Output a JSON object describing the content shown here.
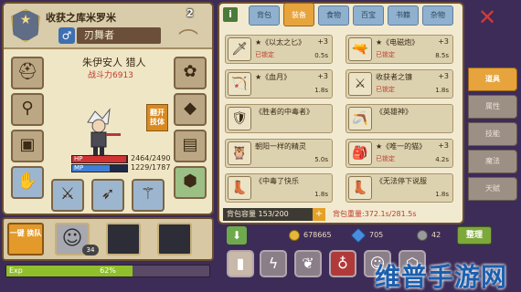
{
  "character": {
    "title": "收获之库米罗米",
    "name": "刃舞者",
    "gender_symbol": "♂",
    "page_number": "2",
    "class_line": "朱伊安人 猎人",
    "power": "战斗力6913",
    "recruit_tag": "翻开 技体",
    "hp": {
      "label": "HP",
      "value": "2464/2490",
      "fraction": 0.99
    },
    "mp": {
      "label": "MP",
      "value": "1229/1787",
      "fraction": 0.69
    }
  },
  "team": {
    "one_click_label": "一键 换队",
    "level_badge": "34"
  },
  "exp": {
    "label": "Exp",
    "percent_text": "62%",
    "fraction": 0.62
  },
  "tabs": [
    {
      "label": "背包",
      "active": false
    },
    {
      "label": "装备",
      "active": true
    },
    {
      "label": "食物",
      "active": false
    },
    {
      "label": "百宝",
      "active": false
    },
    {
      "label": "书籍",
      "active": false
    },
    {
      "label": "杂物",
      "active": false
    }
  ],
  "items": [
    {
      "name": "★《以太之匕》",
      "plus": "+3",
      "lock": "已锁定",
      "time": "0.5s",
      "icon": "🗡"
    },
    {
      "name": "★《电磁炮》",
      "plus": "+3",
      "lock": "已锁定",
      "time": "8.5s",
      "icon": "🔫"
    },
    {
      "name": "★《血月》",
      "plus": "+3",
      "lock": "",
      "time": "1.8s",
      "icon": "🏹"
    },
    {
      "name": "收获者之镰",
      "plus": "+3",
      "lock": "已锁定",
      "time": "1.8s",
      "icon": "⚔"
    },
    {
      "name": "《胜者的中毒者》",
      "plus": "",
      "lock": "",
      "time": "",
      "icon": "🛡"
    },
    {
      "name": "《英雄神》",
      "plus": "",
      "lock": "",
      "time": "",
      "icon": "🪃"
    },
    {
      "name": "朝阳一样的精灵",
      "plus": "",
      "lock": "",
      "time": "5.0s",
      "icon": "🦉"
    },
    {
      "name": "★《唯一的猫》",
      "plus": "+3",
      "lock": "已锁定",
      "time": "4.2s",
      "icon": "🎒"
    },
    {
      "name": "《中毒了快乐",
      "plus": "",
      "lock": "",
      "time": "1.8s",
      "icon": "👢"
    },
    {
      "name": "《无法停下说服",
      "plus": "",
      "lock": "",
      "time": "1.8s",
      "icon": "👢"
    }
  ],
  "bag": {
    "capacity_text": "背包容量 153/200",
    "weight_text": "背包重量:372.1s/281.5s"
  },
  "side_tabs": [
    {
      "label": "道具",
      "active": true
    },
    {
      "label": "属性",
      "active": false
    },
    {
      "label": "技能",
      "active": false
    },
    {
      "label": "魔法",
      "active": false
    },
    {
      "label": "天赋",
      "active": false
    }
  ],
  "currency": {
    "gold": "678665",
    "gem": "705",
    "coin": "42",
    "sort_label": "整理"
  },
  "watermark": "维普手游网",
  "colors": {
    "accent_orange": "#e7a43d",
    "hp_red": "#d23232",
    "mp_blue": "#3f7fd8",
    "exp_green": "#8fbf2a",
    "lock_red": "#c0392b"
  }
}
